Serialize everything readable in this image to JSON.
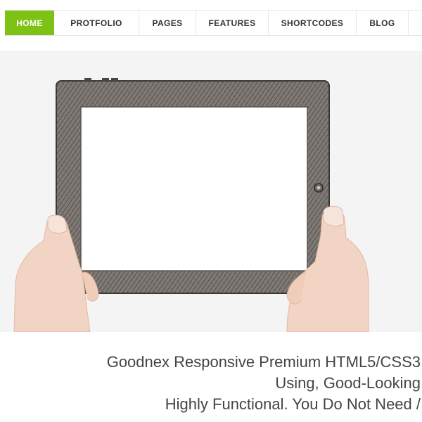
{
  "colors": {
    "accent": "#7dc215",
    "hero_background": "#f4f4f4",
    "text": "#444444"
  },
  "nav": {
    "items": [
      {
        "label": "HOME",
        "active": true
      },
      {
        "label": "PROTFOLIO"
      },
      {
        "label": "PAGES"
      },
      {
        "label": "FEATURES"
      },
      {
        "label": "SHORTCODES"
      },
      {
        "label": "BLOG"
      },
      {
        "label": ""
      }
    ]
  },
  "hero": {
    "image": "hands-holding-sketched-tablet"
  },
  "caption": {
    "line1": "Goodnex Responsive Premium HTML5/CSS3",
    "line2": "Using, Good-Looking",
    "line3": "Highly Functional. You Do Not Need /"
  }
}
